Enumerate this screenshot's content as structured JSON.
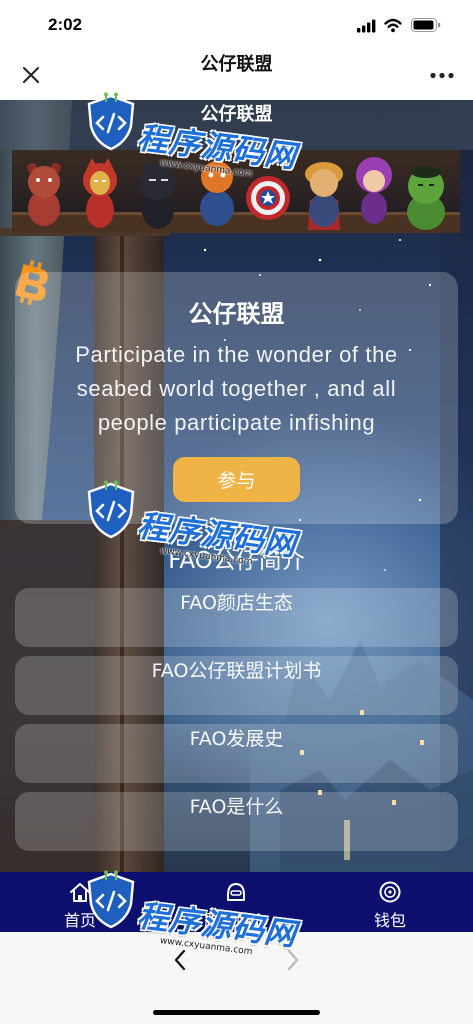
{
  "status_bar": {
    "time": "2:02",
    "icons": [
      "cellular-signal-icon",
      "wifi-icon",
      "battery-icon"
    ]
  },
  "nav": {
    "title": "公仔联盟",
    "left_icon": "close-icon",
    "right_icon": "more-icon"
  },
  "page": {
    "title": "公仔联盟",
    "banner": "figures-banner-image"
  },
  "intro_card": {
    "icon": "bitcoin-icon",
    "title": "公仔联盟",
    "description": "Participate in the wonder of the seabed world together , and all people participate infishing",
    "join_button": "参与"
  },
  "section": {
    "heading": "FAO公仔简介",
    "items": [
      {
        "label": "FAO颜店生态"
      },
      {
        "label": "FAO公仔联盟计划书"
      },
      {
        "label": "FAO发展史"
      },
      {
        "label": "FAO是什么"
      }
    ]
  },
  "tab_bar": {
    "items": [
      {
        "label": "首页",
        "icon": "home-icon"
      },
      {
        "label": "服务中心",
        "icon": "service-center-icon"
      },
      {
        "label": "钱包",
        "icon": "wallet-icon"
      }
    ]
  },
  "browser_bar": {
    "back_icon": "back-arrow-icon",
    "forward_icon": "forward-arrow-icon"
  },
  "watermark": {
    "text": "程序源码网",
    "url": "www.cxyuanma.com"
  },
  "colors": {
    "accent": "#f0b446",
    "tab_bar": "#0c0f6e",
    "bitcoin": "#f7931a",
    "watermark": "#1e6fd9"
  }
}
